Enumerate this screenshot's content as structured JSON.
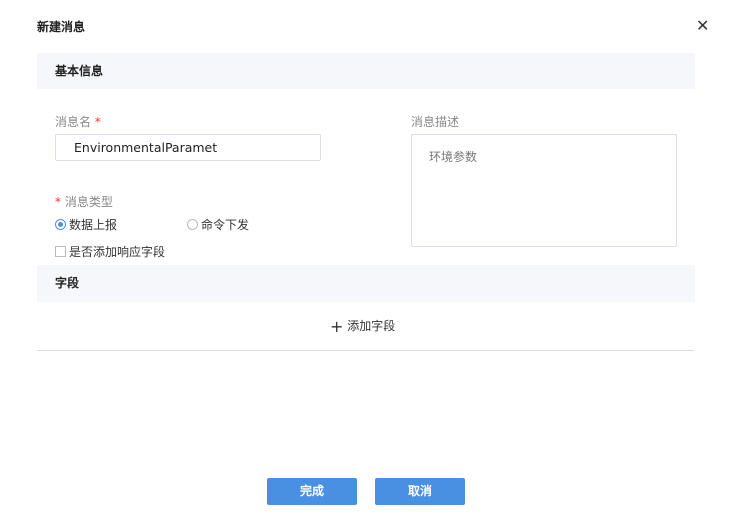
{
  "dialog": {
    "title": "新建消息",
    "close_icon": "close-icon"
  },
  "basic": {
    "header": "基本信息",
    "name_label": "消息名",
    "name_value": "EnvironmentalParamet",
    "desc_label": "消息描述",
    "desc_value": "环境参数",
    "type_label": "消息类型",
    "required_mark": "*",
    "type_options": [
      {
        "label": "数据上报",
        "selected": true
      },
      {
        "label": "命令下发",
        "selected": false
      }
    ],
    "response_checkbox": {
      "label": "是否添加响应字段",
      "checked": false
    }
  },
  "fields": {
    "header": "字段",
    "add_label": "添加字段"
  },
  "footer": {
    "ok": "完成",
    "cancel": "取消"
  },
  "colors": {
    "primary": "#4a90e2",
    "required": "#e4393c"
  }
}
